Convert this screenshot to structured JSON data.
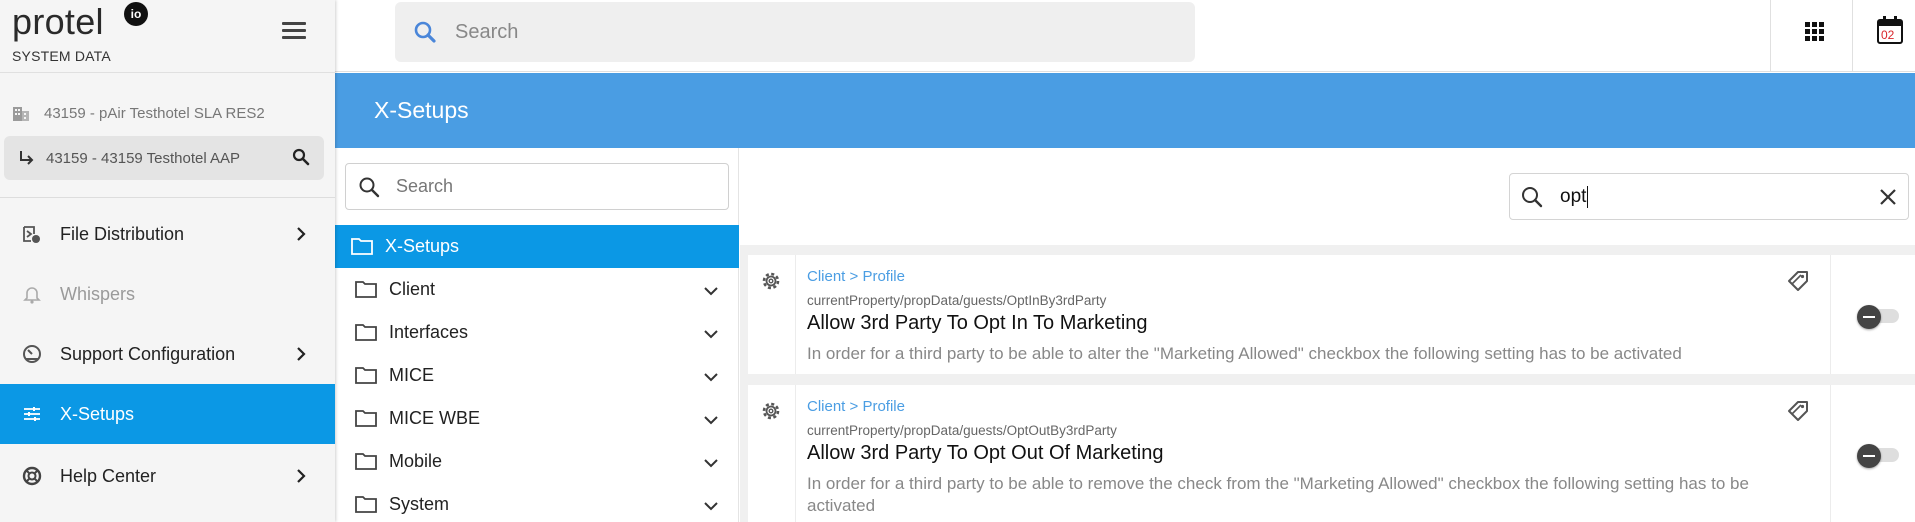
{
  "app": {
    "logo_text": "protel",
    "logo_mark": "io",
    "subtitle": "SYSTEM DATA"
  },
  "property": {
    "primary": "43159 - pAir Testhotel SLA RES2",
    "secondary": "43159 - 43159  Testhotel AAP"
  },
  "sidebar": {
    "items": [
      {
        "label": "File Distribution",
        "icon": "file-distribution-icon",
        "has_chevron": true,
        "state": "normal"
      },
      {
        "label": "Whispers",
        "icon": "bell-icon",
        "has_chevron": false,
        "state": "disabled"
      },
      {
        "label": "Support Configuration",
        "icon": "speedometer-icon",
        "has_chevron": true,
        "state": "normal"
      },
      {
        "label": "X-Setups",
        "icon": "sliders-icon",
        "has_chevron": false,
        "state": "active"
      },
      {
        "label": "Help Center",
        "icon": "lifebuoy-icon",
        "has_chevron": true,
        "state": "normal"
      }
    ]
  },
  "topbar": {
    "search_placeholder": "Search",
    "calendar_day": "02"
  },
  "page": {
    "title": "X-Setups"
  },
  "tree": {
    "search_placeholder": "Search",
    "items": [
      {
        "label": "X-Setups",
        "active": true,
        "expandable": false
      },
      {
        "label": "Client",
        "active": false,
        "expandable": true
      },
      {
        "label": "Interfaces",
        "active": false,
        "expandable": true
      },
      {
        "label": "MICE",
        "active": false,
        "expandable": true
      },
      {
        "label": "MICE WBE",
        "active": false,
        "expandable": true
      },
      {
        "label": "Mobile",
        "active": false,
        "expandable": true
      },
      {
        "label": "System",
        "active": false,
        "expandable": true
      }
    ]
  },
  "filter": {
    "value": "opt"
  },
  "results": [
    {
      "breadcrumb": "Client > Profile",
      "path": "currentProperty/propData/guests/OptInBy3rdParty",
      "title": "Allow 3rd Party To Opt In To Marketing",
      "description": "In order for a third party to be able to alter the \"Marketing Allowed\" checkbox the following setting has to be activated",
      "enabled": false
    },
    {
      "breadcrumb": "Client > Profile",
      "path": "currentProperty/propData/guests/OptOutBy3rdParty",
      "title": "Allow 3rd Party To Opt Out Of Marketing",
      "description": "In order for a third party to be able to remove the check from the \"Marketing Allowed\" checkbox the following setting has to be activated",
      "enabled": false
    }
  ],
  "colors": {
    "accent_blue": "#0b98e5",
    "header_blue": "#4a9de3",
    "link_blue": "#4a9de3",
    "calendar_red": "#d9252a"
  }
}
